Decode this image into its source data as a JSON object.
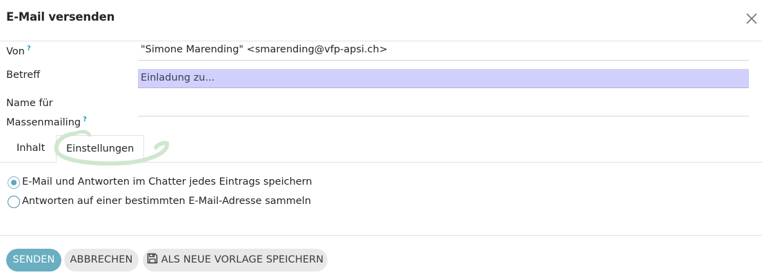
{
  "dialog": {
    "title": "E-Mail versenden",
    "close_icon": "close-icon"
  },
  "form": {
    "from_label": "Von",
    "from_value": "\"Simone Marending\" <smarending@vfp-apsi.ch>",
    "subject_label": "Betreff",
    "subject_value": "Einladung zu...",
    "mass_name_label_line1": "Name für",
    "mass_name_label_line2": "Massenmailing",
    "mass_name_value": "",
    "help_marker": "?"
  },
  "tabs": [
    {
      "label": "Inhalt",
      "active": false
    },
    {
      "label": "Einstellungen",
      "active": true
    }
  ],
  "settings": {
    "option_chatter": "E-Mail und Antworten im Chatter jedes Eintrags speichern",
    "option_chatter_checked": true,
    "option_collect": "Antworten auf einer bestimmten E-Mail-Adresse sammeln",
    "option_collect_checked": false
  },
  "footer": {
    "send_label": "SENDEN",
    "cancel_label": "ABBRECHEN",
    "save_template_label": "ALS NEUE VORLAGE SPEICHERN",
    "save_template_icon": "floppy-disk-icon"
  },
  "colors": {
    "primary": "#6aaec2",
    "subject_highlight": "#d0d0fb",
    "annotation": "#c8e6c9",
    "help": "#17a2b8"
  }
}
